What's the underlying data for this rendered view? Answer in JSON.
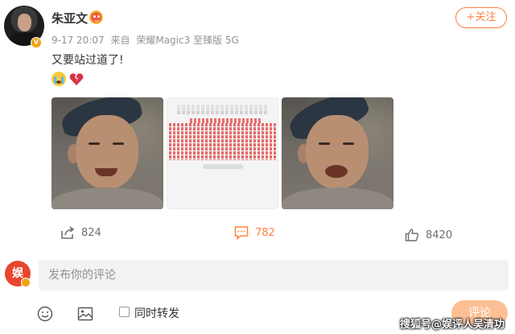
{
  "post": {
    "author": "朱亚文",
    "date": "9-17 20:07",
    "source_prefix": "来自",
    "device": "荣耀Magic3 至臻版 5G",
    "follow_label": "+关注",
    "text": "又要站过道了!",
    "emojis": [
      "crying-face",
      "broken-heart"
    ]
  },
  "images": [
    {
      "kind": "photo",
      "icon": "face-photo"
    },
    {
      "kind": "screenshot",
      "icon": "seat-map-screenshot"
    },
    {
      "kind": "photo",
      "icon": "face-photo"
    }
  ],
  "actions": {
    "share_count": "824",
    "comment_count": "782",
    "like_count": "8420"
  },
  "comment_box": {
    "avatar_char": "娱",
    "placeholder": "发布你的评论",
    "repost_label": "同时转发",
    "submit_label": "评论"
  },
  "watermark": "搜狐号@娱评人吴清功",
  "colors": {
    "accent": "#ff8140",
    "seat_red": "#e96a6a",
    "submit_bg": "#fdbf94"
  }
}
